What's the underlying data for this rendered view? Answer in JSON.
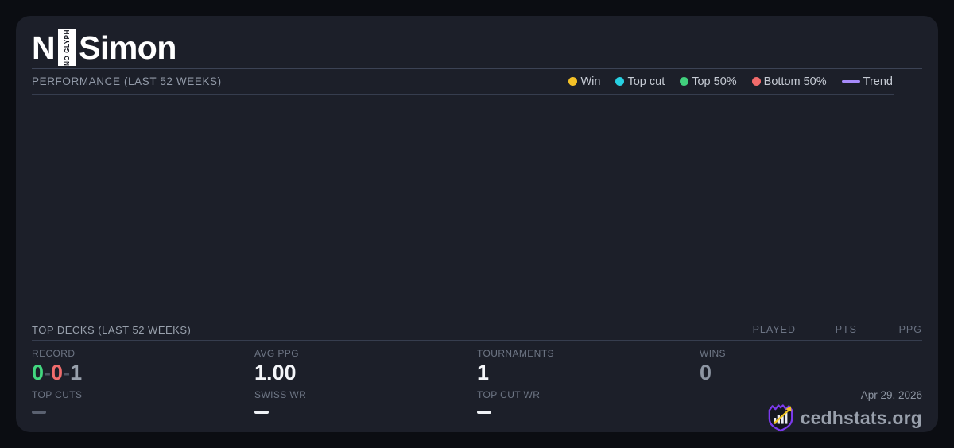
{
  "player": {
    "title_prefix": "N",
    "missing_glyph_label": "NO GLYPH",
    "title_suffix": "Simon"
  },
  "performance": {
    "heading": "PERFORMANCE (LAST 52 WEEKS)",
    "legend": [
      {
        "label": "Win",
        "color": "#f4c127",
        "type": "dot"
      },
      {
        "label": "Top cut",
        "color": "#27d0e2",
        "type": "dot"
      },
      {
        "label": "Top 50%",
        "color": "#41d07d",
        "type": "dot"
      },
      {
        "label": "Bottom 50%",
        "color": "#f16b6b",
        "type": "dot"
      },
      {
        "label": "Trend",
        "color": "#a78bfa",
        "type": "line"
      }
    ],
    "chart_points": []
  },
  "top_decks": {
    "heading": "TOP DECKS (LAST 52 WEEKS)",
    "columns": [
      "PLAYED",
      "PTS",
      "PPG"
    ],
    "rows": []
  },
  "stats": {
    "record": {
      "label": "RECORD",
      "parts": [
        {
          "text": "0",
          "color": "#42d77f"
        },
        {
          "text": "-",
          "color": "#4d5463"
        },
        {
          "text": "0",
          "color": "#f06c6c"
        },
        {
          "text": "-",
          "color": "#4d5463"
        },
        {
          "text": "1",
          "color": "#99a1ad"
        }
      ]
    },
    "avg_ppg": {
      "label": "AVG PPG",
      "value": "1.00",
      "color": "#f4f6f9"
    },
    "tournaments": {
      "label": "TOURNAMENTS",
      "value": "1",
      "color": "#f4f6f9"
    },
    "wins": {
      "label": "WINS",
      "value": "0",
      "color": "#8d95a2"
    },
    "top_cuts": {
      "label": "TOP CUTS",
      "dash_color": "#5a6170"
    },
    "swiss_wr": {
      "label": "SWISS WR",
      "dash_color": "#eef1f5"
    },
    "top_cut_wr": {
      "label": "TOP CUT WR",
      "dash_color": "#eef1f5"
    }
  },
  "footer": {
    "date": "Apr 29, 2026",
    "brand": "cedhstats.org"
  },
  "colors": {
    "shield_purple": "#7c3aed",
    "arrow_gold": "#f0c420",
    "bar_white": "#e9ebf1"
  }
}
